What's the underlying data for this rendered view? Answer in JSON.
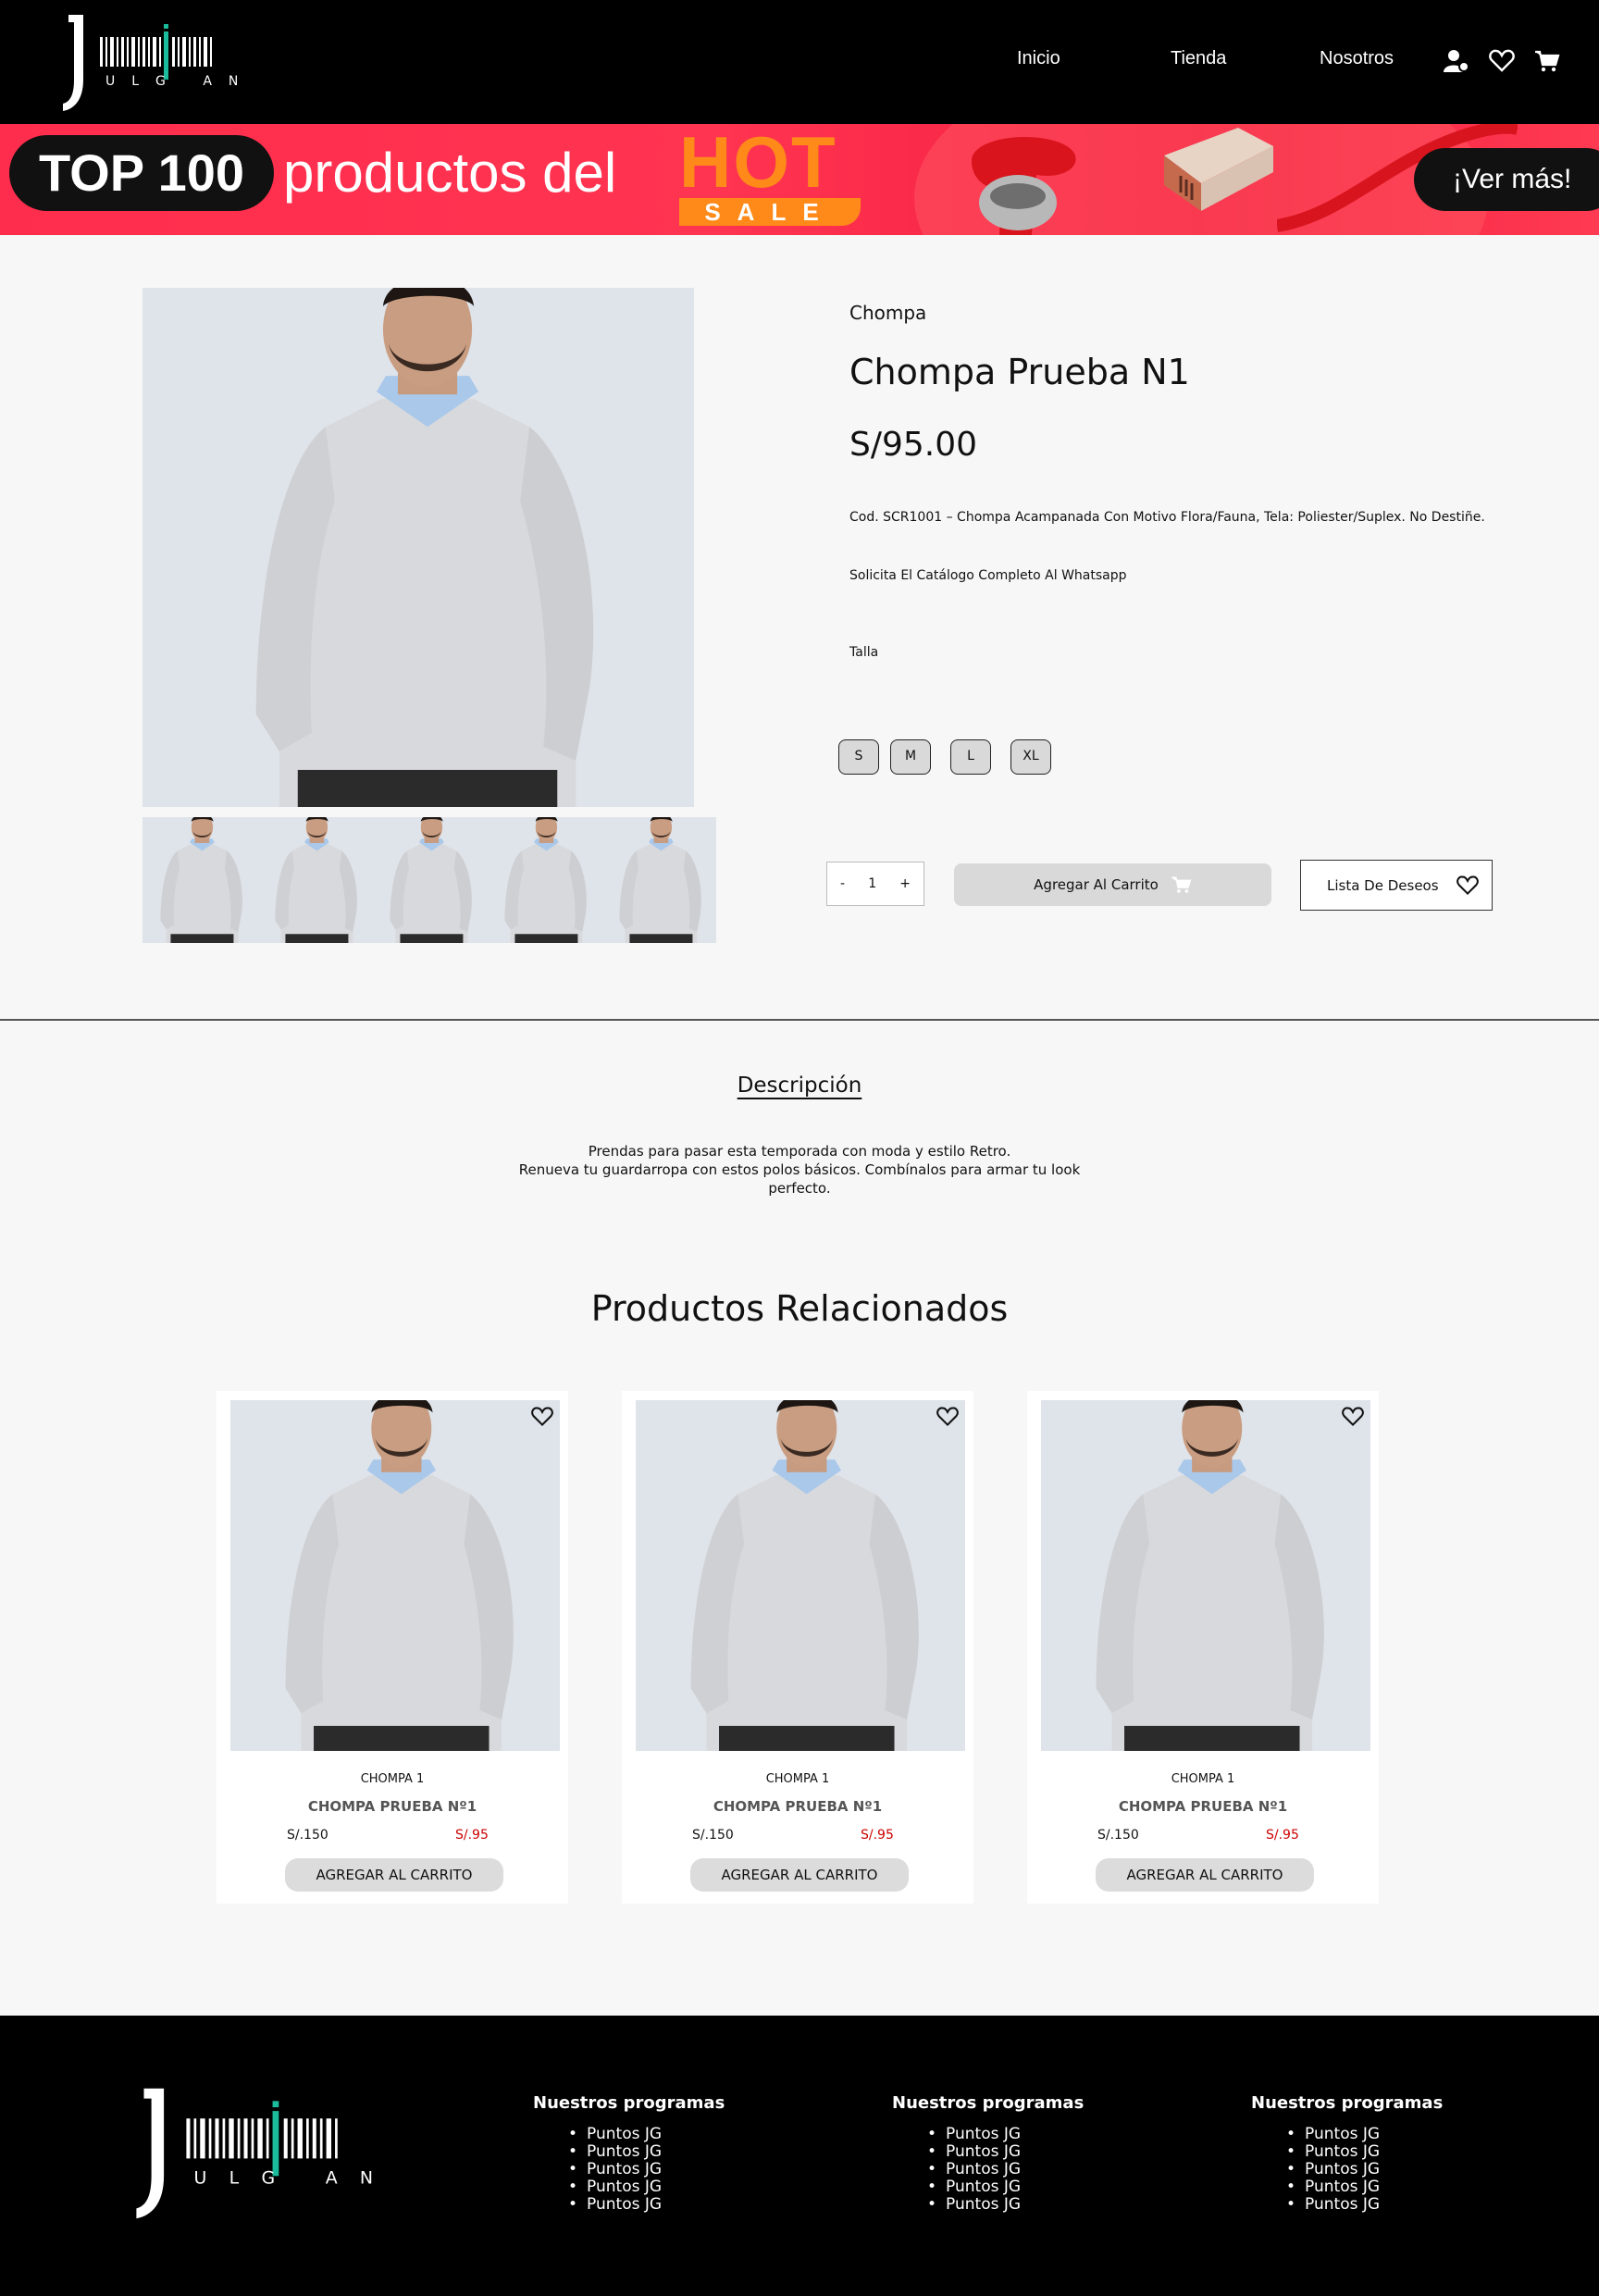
{
  "header": {
    "logo_text": "JULGIAN",
    "nav": [
      "Inicio",
      "Tienda",
      "Nosotros"
    ],
    "icons": [
      "user-settings-icon",
      "heart-icon",
      "cart-icon"
    ]
  },
  "banner": {
    "badge": "TOP 100",
    "text": "productos del",
    "hot": "HOT",
    "sale": "SALE",
    "cta": "¡Ver más!"
  },
  "product": {
    "category": "Chompa",
    "title": "Chompa Prueba N1",
    "price": "S/95.00",
    "description": "Cod. SCR1001 – Chompa Acampanada Con Motivo Flora/Fauna, Tela: Poliester/Suplex. No Destiñe.",
    "note": "Solicita El Catálogo Completo Al Whatsapp",
    "size_label": "Talla",
    "sizes": [
      "S",
      "M",
      "L",
      "XL"
    ],
    "qty_minus": "-",
    "qty": "1",
    "qty_plus": "+",
    "add_to_cart": "Agregar Al Carrito",
    "wishlist": "Lista De Deseos"
  },
  "description_section": {
    "title": "Descripción",
    "line1": "Prendas para pasar esta temporada con moda y estilo Retro.",
    "line2": "Renueva tu guardarropa con estos polos básicos. Combínalos para armar tu look",
    "line3": "perfecto."
  },
  "related": {
    "title": "Productos Relacionados",
    "cards": [
      {
        "category": "CHOMPA 1",
        "name": "CHOMPA PRUEBA Nº1",
        "old_price": "S/.150",
        "price": "S/.95",
        "button": "AGREGAR AL CARRITO"
      },
      {
        "category": "CHOMPA 1",
        "name": "CHOMPA PRUEBA Nº1",
        "old_price": "S/.150",
        "price": "S/.95",
        "button": "AGREGAR AL CARRITO"
      },
      {
        "category": "CHOMPA 1",
        "name": "CHOMPA PRUEBA Nº1",
        "old_price": "S/.150",
        "price": "S/.95",
        "button": "AGREGAR AL CARRITO"
      }
    ]
  },
  "footer": {
    "logo_text": "JULGIAN",
    "columns": [
      {
        "title": "Nuestros programas",
        "items": [
          "Puntos JG",
          "Puntos JG",
          "Puntos JG",
          "Puntos JG",
          "Puntos JG"
        ]
      },
      {
        "title": "Nuestros programas",
        "items": [
          "Puntos JG",
          "Puntos JG",
          "Puntos JG",
          "Puntos JG",
          "Puntos JG"
        ]
      },
      {
        "title": "Nuestros programas",
        "items": [
          "Puntos JG",
          "Puntos JG",
          "Puntos JG",
          "Puntos JG",
          "Puntos JG"
        ]
      }
    ]
  },
  "colors": {
    "accent": "#1abc9c",
    "sale_red": "#cc0000",
    "banner": "#ff2d4d",
    "hot": "#ff8a1a"
  }
}
